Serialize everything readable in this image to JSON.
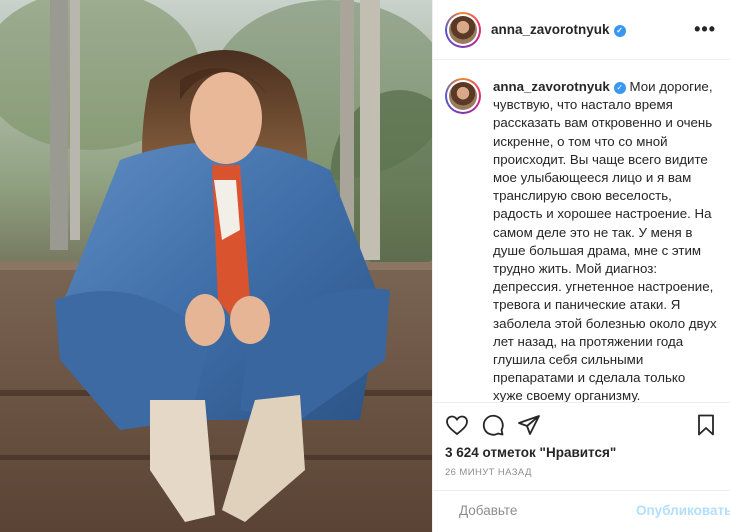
{
  "post": {
    "username": "anna_zavorotnyuk",
    "verified_icon": "verified-badge-icon",
    "more_icon": "more-options-icon",
    "caption": "Мои дорогие, чувствую, что настало время рассказать вам откровенно и очень искренне, о том что со мной происходит. Вы чаще всего видите мое улыбающееся лицо и я вам транслирую свою веселость, радость и хорошее настроение. На самом деле это не так. У меня в душе большая драма, мне с этим трудно жить. Мой диагноз: депрессия. угнетенное настроение, тревога и панические атаки. Я заболела этой болезнью около двух лет назад, на протяжении года глушила себя сильными препаратами и сделала только хуже своему организму. Оставшийся год я борюсь с ней с помощью специалистов. Я отказалась от общения с друзьями",
    "likes": "3 624 отметок \"Нравится\"",
    "time_ago": "26 МИНУТ НАЗАД",
    "comment_placeholder": "Добавьте",
    "publish_label": "Опубликовать"
  },
  "colors": {
    "verified": "#3897f0",
    "publish_disabled": "#b2dffc",
    "muted_text": "#8e8e8e"
  },
  "icons": [
    "heart-icon",
    "comment-icon",
    "share-icon",
    "bookmark-icon",
    "emoji-icon"
  ]
}
